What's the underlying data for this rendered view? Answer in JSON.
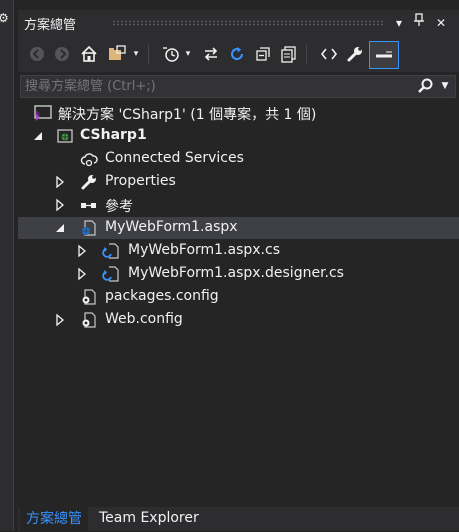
{
  "panel": {
    "title": "方案總管",
    "header_buttons": [
      {
        "icon": "dropdown-triangle-icon",
        "glyph": "▾"
      },
      {
        "icon": "pin-icon",
        "glyph": "⊥"
      },
      {
        "icon": "close-icon",
        "glyph": "✕"
      }
    ]
  },
  "toolbar": {
    "items": [
      "back-icon",
      "forward-icon",
      "home-icon",
      "switch-views-icon",
      "switch-views-dropdown-icon",
      "pending-changes-filter-icon",
      "pending-changes-dropdown-icon",
      "sync-with-active-document-icon",
      "refresh-icon",
      "collapse-all-icon",
      "show-all-files-icon",
      "view-code-icon",
      "properties-icon",
      "preview-selected-items-icon"
    ]
  },
  "search": {
    "placeholder": "搜尋方案總管 (Ctrl+;)"
  },
  "tree": {
    "solution_label": "解決方案 'CSharp1' (1 個專案，共 1 個)",
    "project_label": "CSharp1",
    "connected_services": "Connected Services",
    "properties": "Properties",
    "references": "參考",
    "webform": "MyWebForm1.aspx",
    "webform_cs": "MyWebForm1.aspx.cs",
    "webform_designer": "MyWebForm1.aspx.designer.cs",
    "packages": "packages.config",
    "webconfig": "Web.config"
  },
  "tabs": {
    "solution_explorer": "方案總管",
    "team_explorer": "Team Explorer"
  },
  "colors": {
    "background": "#252526",
    "chrome": "#2d2d30",
    "text": "#f1f1f1",
    "accent": "#3794ff",
    "selection": "#3f3f46"
  }
}
